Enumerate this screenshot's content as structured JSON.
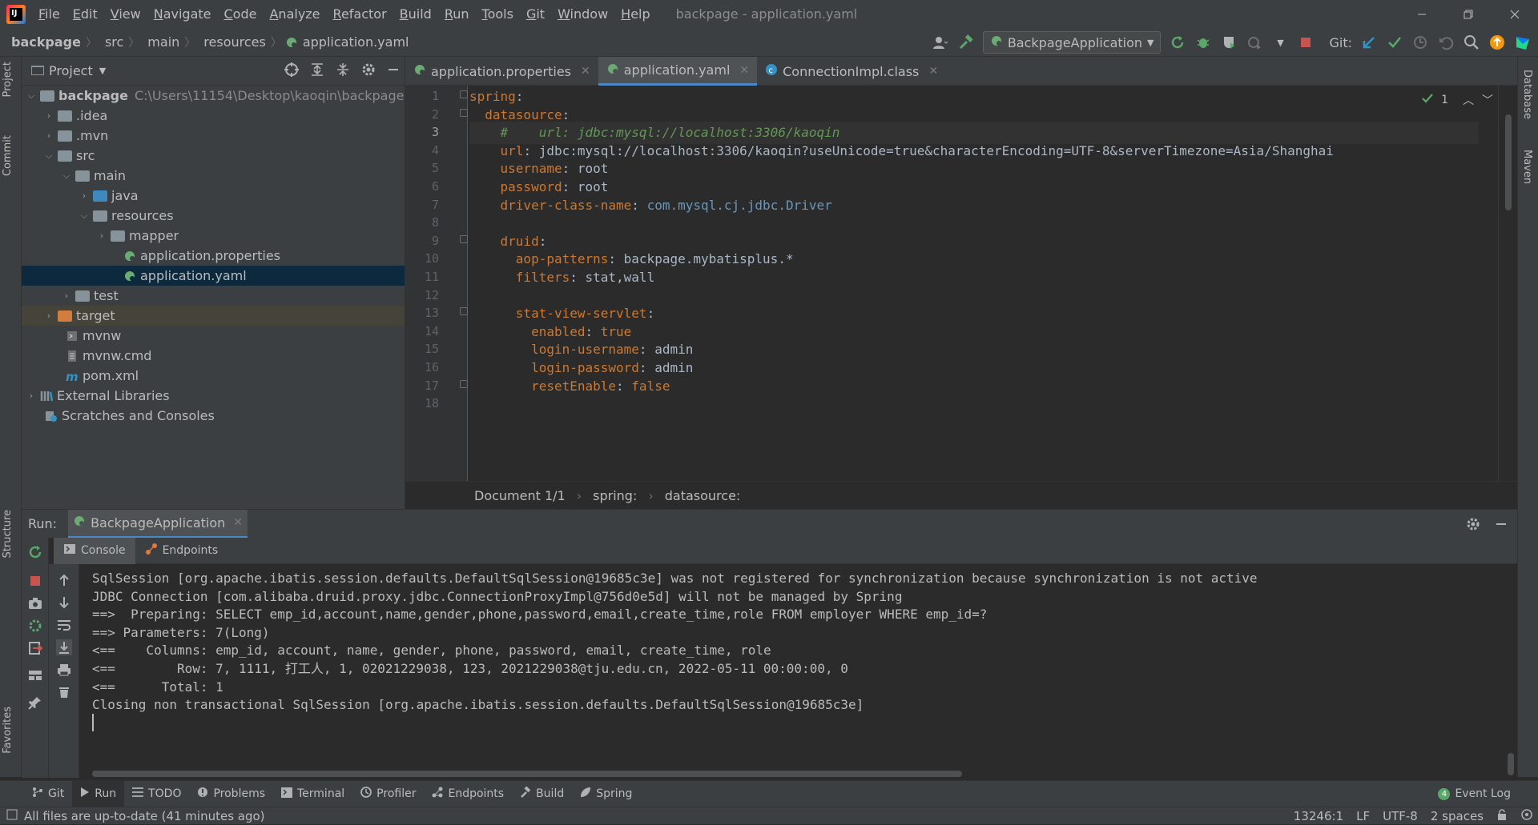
{
  "window": {
    "title": "backpage - application.yaml",
    "menu": [
      "File",
      "Edit",
      "View",
      "Navigate",
      "Code",
      "Analyze",
      "Refactor",
      "Build",
      "Run",
      "Tools",
      "Git",
      "Window",
      "Help"
    ]
  },
  "nav": {
    "breadcrumbs": [
      "backpage",
      "src",
      "main",
      "resources",
      "application.yaml"
    ],
    "run_config": "BackpageApplication",
    "git_label": "Git:"
  },
  "left_strip": {
    "tabs": [
      "Project",
      "Commit",
      "Structure",
      "Favorites"
    ]
  },
  "right_strip": {
    "tabs": [
      "Database",
      "Maven"
    ]
  },
  "project": {
    "title": "Project",
    "root_label": "backpage",
    "root_path": "C:\\Users\\11154\\Desktop\\kaoqin\\backpage",
    "items": [
      {
        "label": ".idea"
      },
      {
        "label": ".mvn"
      },
      {
        "label": "src"
      },
      {
        "label": "main"
      },
      {
        "label": "java"
      },
      {
        "label": "resources"
      },
      {
        "label": "mapper"
      },
      {
        "label": "application.properties"
      },
      {
        "label": "application.yaml"
      },
      {
        "label": "test"
      },
      {
        "label": "target"
      },
      {
        "label": "mvnw"
      },
      {
        "label": "mvnw.cmd"
      },
      {
        "label": "pom.xml"
      },
      {
        "label": "External Libraries"
      },
      {
        "label": "Scratches and Consoles"
      }
    ]
  },
  "editor": {
    "tabs": [
      "application.properties",
      "application.yaml",
      "ConnectionImpl.class"
    ],
    "active_tab": "application.yaml",
    "inspection_count": "1",
    "line_numbers": [
      "1",
      "2",
      "3",
      "4",
      "5",
      "6",
      "7",
      "8",
      "9",
      "10",
      "11",
      "12",
      "13",
      "14",
      "15",
      "16",
      "17",
      "18"
    ],
    "lines": [
      {
        "key": "spring",
        "sep": ":",
        "val": ""
      },
      {
        "key": "datasource",
        "sep": ":",
        "val": ""
      },
      {
        "comment": "#    url: jdbc:mysql://localhost:3306/kaoqin"
      },
      {
        "key": "url",
        "sep": ": ",
        "val": "jdbc:mysql://localhost:3306/kaoqin?useUnicode=true&characterEncoding=UTF-8&serverTimezone=Asia/Shanghai"
      },
      {
        "key": "username",
        "sep": ": ",
        "val": "root"
      },
      {
        "key": "password",
        "sep": ": ",
        "val": "root"
      },
      {
        "key": "driver-class-name",
        "sep": ": ",
        "val": "com.mysql.cj.jdbc.Driver"
      },
      {
        "key": "",
        "sep": "",
        "val": ""
      },
      {
        "key": "druid",
        "sep": ":",
        "val": ""
      },
      {
        "key": "aop-patterns",
        "sep": ": ",
        "val": "backpage.mybatisplus.*"
      },
      {
        "key": "filters",
        "sep": ": ",
        "val": "stat,wall"
      },
      {
        "key": "",
        "sep": "",
        "val": ""
      },
      {
        "key": "stat-view-servlet",
        "sep": ":",
        "val": ""
      },
      {
        "key": "enabled",
        "sep": ": ",
        "val": "true"
      },
      {
        "key": "login-username",
        "sep": ": ",
        "val": "admin"
      },
      {
        "key": "login-password",
        "sep": ": ",
        "val": "admin"
      },
      {
        "key": "resetEnable",
        "sep": ": ",
        "val": "false"
      },
      {
        "key": "",
        "sep": "",
        "val": ""
      }
    ],
    "breadcrumb": [
      "Document 1/1",
      "spring:",
      "datasource:"
    ]
  },
  "run": {
    "label": "Run:",
    "tab": "BackpageApplication",
    "subtabs": [
      "Console",
      "Endpoints"
    ],
    "console_lines": [
      "SqlSession [org.apache.ibatis.session.defaults.DefaultSqlSession@19685c3e] was not registered for synchronization because synchronization is not active",
      "JDBC Connection [com.alibaba.druid.proxy.jdbc.ConnectionProxyImpl@756d0e5d] will not be managed by Spring",
      "==>  Preparing: SELECT emp_id,account,name,gender,phone,password,email,create_time,role FROM employer WHERE emp_id=?",
      "==> Parameters: 7(Long)",
      "<==    Columns: emp_id, account, name, gender, phone, password, email, create_time, role",
      "<==        Row: 7, 1111, 打工人, 1, 02021229038, 123, 2021229038@tju.edu.cn, 2022-05-11 00:00:00, 0",
      "<==      Total: 1",
      "Closing non transactional SqlSession [org.apache.ibatis.session.defaults.DefaultSqlSession@19685c3e]"
    ]
  },
  "bottom_tools": [
    "Git",
    "Run",
    "TODO",
    "Problems",
    "Terminal",
    "Profiler",
    "Endpoints",
    "Build",
    "Spring"
  ],
  "event_log": {
    "label": "Event Log",
    "count": "4"
  },
  "status": {
    "message": "All files are up-to-date (41 minutes ago)",
    "position": "13246:1",
    "line_sep": "LF",
    "encoding": "UTF-8",
    "indent": "2 spaces"
  }
}
